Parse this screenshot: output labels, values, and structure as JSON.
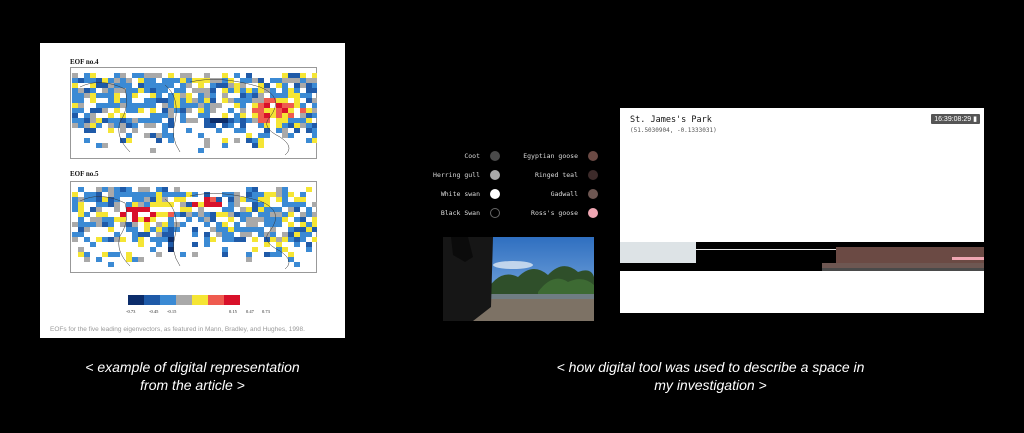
{
  "eof_figure": {
    "map1_title": "EOF no.4",
    "map2_title": "EOF no.5",
    "legend_colors": [
      "#0c2d6b",
      "#1f5aa8",
      "#3b8ad4",
      "#a9a9a9",
      "#f5e534",
      "#ef5b4f",
      "#d8112a"
    ],
    "legend_ticks": [
      "-0.73",
      "-0.45",
      "-0.15",
      "0.15",
      "0.47",
      "0.73"
    ],
    "caption": "EOFs for the five leading eigenvectors, as featured in Mann, Bradley, and Hughes, 1998."
  },
  "left_caption": {
    "line1": "< example of digital representation",
    "line2": "from the article >"
  },
  "right_caption": {
    "line1": "< how digital tool was used to describe a space in",
    "line2": "my investigation  >"
  },
  "birds_left": [
    {
      "name": "Coot",
      "color": "#4a4a4a",
      "outline": false
    },
    {
      "name": "Herring gull",
      "color": "#a8a8a8",
      "outline": false
    },
    {
      "name": "White swan",
      "color": "#ffffff",
      "outline": false
    },
    {
      "name": "Black Swan",
      "color": "#000000",
      "outline": true
    }
  ],
  "birds_right": [
    {
      "name": "Egyptian goose",
      "color": "#6b4a44",
      "outline": false
    },
    {
      "name": "Ringed teal",
      "color": "#3d2b2a",
      "outline": false
    },
    {
      "name": "Gadwall",
      "color": "#6e5752",
      "outline": false
    },
    {
      "name": "Ross's goose",
      "color": "#f0a7b3",
      "outline": false
    }
  ],
  "park": {
    "name": "St. James's Park",
    "coords": "(51.5030904, -0.1333031)",
    "time": "16:39:08:29"
  }
}
